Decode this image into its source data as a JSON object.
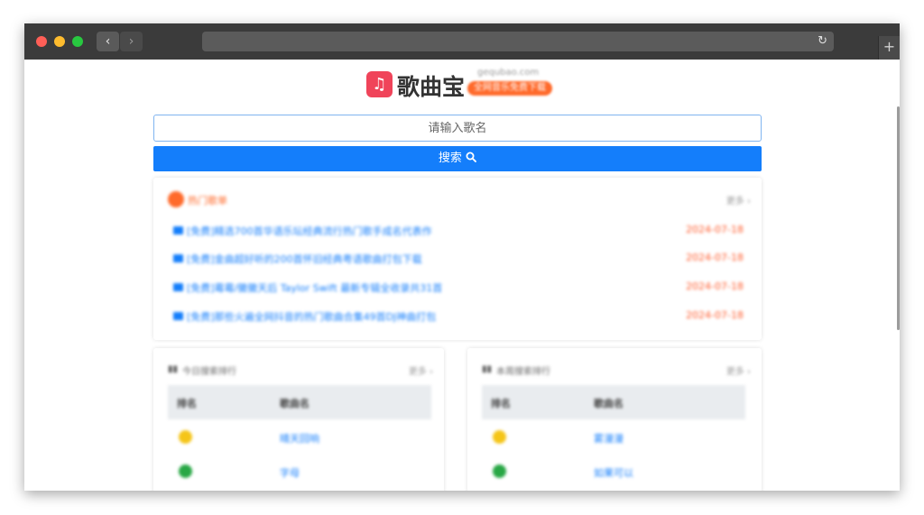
{
  "browser": {
    "back_label": "‹",
    "forward_label": "›",
    "reload_label": "↻",
    "new_tab_label": "+"
  },
  "logo": {
    "icon": "♫",
    "name": "歌曲宝",
    "domain": "gequbao.com",
    "tagline": "全网音乐免费下载"
  },
  "search": {
    "placeholder": "请输入歌名",
    "button_label": "搜索"
  },
  "hot": {
    "title": "热门歌单",
    "more_label": "更多 ›",
    "items": [
      {
        "title": "[免费]精选700首华语乐坛经典流行热门歌手成名代表作",
        "date": "2024-07-18"
      },
      {
        "title": "[免费]金曲超好听的200首怀旧经典粤语歌曲打包下载",
        "date": "2024-07-18"
      },
      {
        "title": "[免费]霉霉/黴黴天后 Taylor Swift 最新专辑全收录共31首",
        "date": "2024-07-18"
      },
      {
        "title": "[免费]那些火遍全网抖音的热门歌曲合集49首DJ神曲打包",
        "date": "2024-07-18"
      }
    ]
  },
  "today_rank": {
    "title": "今日搜索排行",
    "more_label": "更多 ›",
    "col_rank": "排名",
    "col_song": "歌曲名",
    "rows": [
      {
        "song": "晴天回响"
      },
      {
        "song": "字母"
      }
    ]
  },
  "week_rank": {
    "title": "本周搜索排行",
    "more_label": "更多 ›",
    "col_rank": "排名",
    "col_song": "歌曲名",
    "rows": [
      {
        "song": "雾漫漫"
      },
      {
        "song": "如果可以"
      }
    ]
  }
}
